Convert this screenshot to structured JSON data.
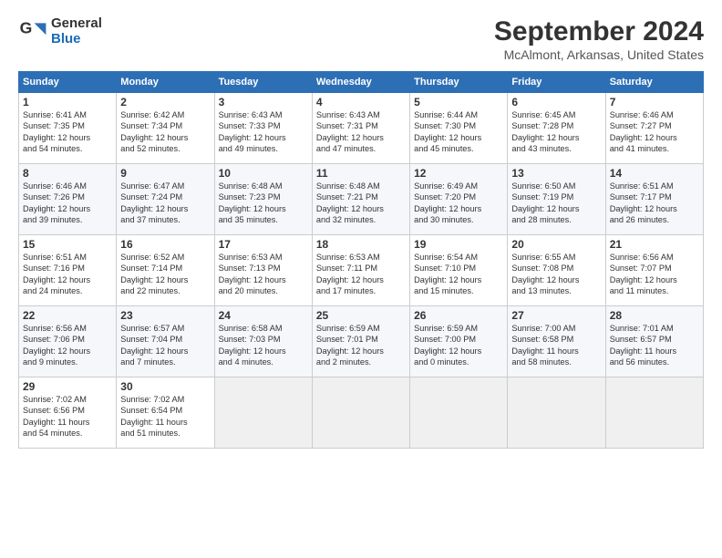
{
  "logo": {
    "general": "General",
    "blue": "Blue"
  },
  "title": "September 2024",
  "subtitle": "McAlmont, Arkansas, United States",
  "days_of_week": [
    "Sunday",
    "Monday",
    "Tuesday",
    "Wednesday",
    "Thursday",
    "Friday",
    "Saturday"
  ],
  "weeks": [
    [
      {
        "num": "1",
        "lines": [
          "Sunrise: 6:41 AM",
          "Sunset: 7:35 PM",
          "Daylight: 12 hours",
          "and 54 minutes."
        ]
      },
      {
        "num": "2",
        "lines": [
          "Sunrise: 6:42 AM",
          "Sunset: 7:34 PM",
          "Daylight: 12 hours",
          "and 52 minutes."
        ]
      },
      {
        "num": "3",
        "lines": [
          "Sunrise: 6:43 AM",
          "Sunset: 7:33 PM",
          "Daylight: 12 hours",
          "and 49 minutes."
        ]
      },
      {
        "num": "4",
        "lines": [
          "Sunrise: 6:43 AM",
          "Sunset: 7:31 PM",
          "Daylight: 12 hours",
          "and 47 minutes."
        ]
      },
      {
        "num": "5",
        "lines": [
          "Sunrise: 6:44 AM",
          "Sunset: 7:30 PM",
          "Daylight: 12 hours",
          "and 45 minutes."
        ]
      },
      {
        "num": "6",
        "lines": [
          "Sunrise: 6:45 AM",
          "Sunset: 7:28 PM",
          "Daylight: 12 hours",
          "and 43 minutes."
        ]
      },
      {
        "num": "7",
        "lines": [
          "Sunrise: 6:46 AM",
          "Sunset: 7:27 PM",
          "Daylight: 12 hours",
          "and 41 minutes."
        ]
      }
    ],
    [
      {
        "num": "8",
        "lines": [
          "Sunrise: 6:46 AM",
          "Sunset: 7:26 PM",
          "Daylight: 12 hours",
          "and 39 minutes."
        ]
      },
      {
        "num": "9",
        "lines": [
          "Sunrise: 6:47 AM",
          "Sunset: 7:24 PM",
          "Daylight: 12 hours",
          "and 37 minutes."
        ]
      },
      {
        "num": "10",
        "lines": [
          "Sunrise: 6:48 AM",
          "Sunset: 7:23 PM",
          "Daylight: 12 hours",
          "and 35 minutes."
        ]
      },
      {
        "num": "11",
        "lines": [
          "Sunrise: 6:48 AM",
          "Sunset: 7:21 PM",
          "Daylight: 12 hours",
          "and 32 minutes."
        ]
      },
      {
        "num": "12",
        "lines": [
          "Sunrise: 6:49 AM",
          "Sunset: 7:20 PM",
          "Daylight: 12 hours",
          "and 30 minutes."
        ]
      },
      {
        "num": "13",
        "lines": [
          "Sunrise: 6:50 AM",
          "Sunset: 7:19 PM",
          "Daylight: 12 hours",
          "and 28 minutes."
        ]
      },
      {
        "num": "14",
        "lines": [
          "Sunrise: 6:51 AM",
          "Sunset: 7:17 PM",
          "Daylight: 12 hours",
          "and 26 minutes."
        ]
      }
    ],
    [
      {
        "num": "15",
        "lines": [
          "Sunrise: 6:51 AM",
          "Sunset: 7:16 PM",
          "Daylight: 12 hours",
          "and 24 minutes."
        ]
      },
      {
        "num": "16",
        "lines": [
          "Sunrise: 6:52 AM",
          "Sunset: 7:14 PM",
          "Daylight: 12 hours",
          "and 22 minutes."
        ]
      },
      {
        "num": "17",
        "lines": [
          "Sunrise: 6:53 AM",
          "Sunset: 7:13 PM",
          "Daylight: 12 hours",
          "and 20 minutes."
        ]
      },
      {
        "num": "18",
        "lines": [
          "Sunrise: 6:53 AM",
          "Sunset: 7:11 PM",
          "Daylight: 12 hours",
          "and 17 minutes."
        ]
      },
      {
        "num": "19",
        "lines": [
          "Sunrise: 6:54 AM",
          "Sunset: 7:10 PM",
          "Daylight: 12 hours",
          "and 15 minutes."
        ]
      },
      {
        "num": "20",
        "lines": [
          "Sunrise: 6:55 AM",
          "Sunset: 7:08 PM",
          "Daylight: 12 hours",
          "and 13 minutes."
        ]
      },
      {
        "num": "21",
        "lines": [
          "Sunrise: 6:56 AM",
          "Sunset: 7:07 PM",
          "Daylight: 12 hours",
          "and 11 minutes."
        ]
      }
    ],
    [
      {
        "num": "22",
        "lines": [
          "Sunrise: 6:56 AM",
          "Sunset: 7:06 PM",
          "Daylight: 12 hours",
          "and 9 minutes."
        ]
      },
      {
        "num": "23",
        "lines": [
          "Sunrise: 6:57 AM",
          "Sunset: 7:04 PM",
          "Daylight: 12 hours",
          "and 7 minutes."
        ]
      },
      {
        "num": "24",
        "lines": [
          "Sunrise: 6:58 AM",
          "Sunset: 7:03 PM",
          "Daylight: 12 hours",
          "and 4 minutes."
        ]
      },
      {
        "num": "25",
        "lines": [
          "Sunrise: 6:59 AM",
          "Sunset: 7:01 PM",
          "Daylight: 12 hours",
          "and 2 minutes."
        ]
      },
      {
        "num": "26",
        "lines": [
          "Sunrise: 6:59 AM",
          "Sunset: 7:00 PM",
          "Daylight: 12 hours",
          "and 0 minutes."
        ]
      },
      {
        "num": "27",
        "lines": [
          "Sunrise: 7:00 AM",
          "Sunset: 6:58 PM",
          "Daylight: 11 hours",
          "and 58 minutes."
        ]
      },
      {
        "num": "28",
        "lines": [
          "Sunrise: 7:01 AM",
          "Sunset: 6:57 PM",
          "Daylight: 11 hours",
          "and 56 minutes."
        ]
      }
    ],
    [
      {
        "num": "29",
        "lines": [
          "Sunrise: 7:02 AM",
          "Sunset: 6:56 PM",
          "Daylight: 11 hours",
          "and 54 minutes."
        ]
      },
      {
        "num": "30",
        "lines": [
          "Sunrise: 7:02 AM",
          "Sunset: 6:54 PM",
          "Daylight: 11 hours",
          "and 51 minutes."
        ]
      },
      null,
      null,
      null,
      null,
      null
    ]
  ]
}
